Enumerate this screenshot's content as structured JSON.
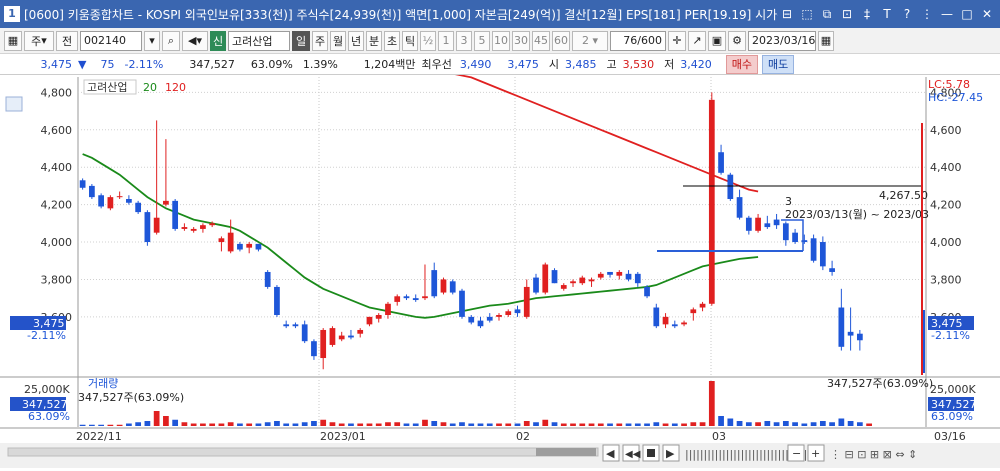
{
  "window": {
    "title": "[0600] 키움종합차트 - KOSPI 외국인보유[333(천)] 주식수[24,939(천)] 액면[1,000] 자본금[249(억)] 결산[12월] EPS[181] PER[19.19] 시가총",
    "number": "1",
    "controls": [
      "⊟",
      "⬚",
      "⧉",
      "⊡",
      "‡",
      "T",
      "?",
      "⋮",
      "—",
      "□",
      "✕"
    ]
  },
  "toolbar": {
    "type": "주",
    "type2": "전",
    "code": "002140",
    "name_badge": "신",
    "stock_name": "고려산업",
    "periods": [
      "일",
      "주",
      "월",
      "년",
      "분",
      "초",
      "틱"
    ],
    "active_period": "일",
    "fraction": "½",
    "nums": [
      "1",
      "3",
      "5",
      "10",
      "30",
      "45",
      "60"
    ],
    "count_sel": "2",
    "range": "76",
    "range_total": "/600",
    "date": "2023/03/16"
  },
  "quote": {
    "price": "3,475",
    "change_arrow": "▼",
    "change": "75",
    "change_pct": "-2.11%",
    "volume": "347,527",
    "vol_ratio": "63.09%",
    "turnover": "1.39%",
    "amount": "1,204백만",
    "best_label": "최우선",
    "bid": "3,490",
    "ask": "3,475",
    "open_label": "시",
    "open": "3,485",
    "high_label": "고",
    "high": "3,530",
    "low_label": "저",
    "low": "3,420",
    "buy": "매수",
    "sell": "매도"
  },
  "chart": {
    "legend_name": "고려산업",
    "ma1": "20",
    "ma2": "120",
    "lc": "LC:5.78",
    "hc": "HC:-27.45",
    "price_tag": "3,475",
    "price_pct": "-2.11%",
    "hline_label": "4,267.50",
    "annot_num": "3",
    "annot_text": "2023/03/13(월) ~ 2023/03",
    "vol_legend": "거래량",
    "vol_value": "347,527주(63.09%)",
    "vol_right": "347,527주(63.09%)",
    "vol_tick": "25,000K",
    "vol_tag": "347,527",
    "vol_tag_pct": "63.09%",
    "dates": [
      "2022/11",
      "2023/01",
      "02",
      "03"
    ],
    "right_date": "03/16",
    "colors": {
      "up": "#e02020",
      "down": "#1e56d8",
      "ma20": "#1a8a1a",
      "ma120": "#e02020"
    }
  },
  "chart_data": {
    "type": "candlestick",
    "y_ticks": [
      3600,
      3800,
      4000,
      4200,
      4400,
      4600,
      4800
    ],
    "ylim": [
      3300,
      4850
    ],
    "candles": [
      {
        "o": 4330,
        "h": 4340,
        "l": 4280,
        "c": 4290
      },
      {
        "o": 4300,
        "h": 4310,
        "l": 4230,
        "c": 4240
      },
      {
        "o": 4250,
        "h": 4260,
        "l": 4180,
        "c": 4190
      },
      {
        "o": 4180,
        "h": 4250,
        "l": 4170,
        "c": 4240
      },
      {
        "o": 4240,
        "h": 4270,
        "l": 4230,
        "c": 4245
      },
      {
        "o": 4230,
        "h": 4250,
        "l": 4200,
        "c": 4210
      },
      {
        "o": 4210,
        "h": 4220,
        "l": 4150,
        "c": 4160
      },
      {
        "o": 4160,
        "h": 4170,
        "l": 3980,
        "c": 4000
      },
      {
        "o": 4050,
        "h": 4650,
        "l": 4040,
        "c": 4130
      },
      {
        "o": 4200,
        "h": 4550,
        "l": 4190,
        "c": 4220
      },
      {
        "o": 4220,
        "h": 4230,
        "l": 4060,
        "c": 4070
      },
      {
        "o": 4070,
        "h": 4100,
        "l": 4060,
        "c": 4080
      },
      {
        "o": 4060,
        "h": 4080,
        "l": 4050,
        "c": 4070
      },
      {
        "o": 4070,
        "h": 4100,
        "l": 4050,
        "c": 4090
      },
      {
        "o": 4090,
        "h": 4110,
        "l": 4080,
        "c": 4100
      },
      {
        "o": 4000,
        "h": 4030,
        "l": 3950,
        "c": 4020
      },
      {
        "o": 3950,
        "h": 4120,
        "l": 3940,
        "c": 4050
      },
      {
        "o": 3990,
        "h": 4000,
        "l": 3950,
        "c": 3960
      },
      {
        "o": 3970,
        "h": 4000,
        "l": 3940,
        "c": 3990
      },
      {
        "o": 3990,
        "h": 3990,
        "l": 3950,
        "c": 3960
      },
      {
        "o": 3840,
        "h": 3850,
        "l": 3750,
        "c": 3760
      },
      {
        "o": 3760,
        "h": 3770,
        "l": 3600,
        "c": 3610
      },
      {
        "o": 3560,
        "h": 3580,
        "l": 3540,
        "c": 3550
      },
      {
        "o": 3560,
        "h": 3570,
        "l": 3540,
        "c": 3550
      },
      {
        "o": 3560,
        "h": 3580,
        "l": 3460,
        "c": 3470
      },
      {
        "o": 3470,
        "h": 3480,
        "l": 3370,
        "c": 3390
      },
      {
        "o": 3380,
        "h": 3540,
        "l": 3320,
        "c": 3530
      },
      {
        "o": 3450,
        "h": 3550,
        "l": 3440,
        "c": 3540
      },
      {
        "o": 3480,
        "h": 3520,
        "l": 3470,
        "c": 3500
      },
      {
        "o": 3500,
        "h": 3530,
        "l": 3480,
        "c": 3490
      },
      {
        "o": 3510,
        "h": 3540,
        "l": 3490,
        "c": 3530
      },
      {
        "o": 3560,
        "h": 3600,
        "l": 3550,
        "c": 3600
      },
      {
        "o": 3590,
        "h": 3620,
        "l": 3570,
        "c": 3610
      },
      {
        "o": 3610,
        "h": 3680,
        "l": 3590,
        "c": 3670
      },
      {
        "o": 3680,
        "h": 3720,
        "l": 3660,
        "c": 3710
      },
      {
        "o": 3710,
        "h": 3720,
        "l": 3690,
        "c": 3700
      },
      {
        "o": 3700,
        "h": 3720,
        "l": 3680,
        "c": 3690
      },
      {
        "o": 3700,
        "h": 3880,
        "l": 3690,
        "c": 3710
      },
      {
        "o": 3850,
        "h": 3890,
        "l": 3700,
        "c": 3710
      },
      {
        "o": 3730,
        "h": 3810,
        "l": 3720,
        "c": 3800
      },
      {
        "o": 3790,
        "h": 3800,
        "l": 3720,
        "c": 3730
      },
      {
        "o": 3740,
        "h": 3750,
        "l": 3590,
        "c": 3600
      },
      {
        "o": 3600,
        "h": 3610,
        "l": 3560,
        "c": 3570
      },
      {
        "o": 3580,
        "h": 3600,
        "l": 3540,
        "c": 3550
      },
      {
        "o": 3600,
        "h": 3620,
        "l": 3570,
        "c": 3580
      },
      {
        "o": 3600,
        "h": 3620,
        "l": 3580,
        "c": 3610
      },
      {
        "o": 3610,
        "h": 3640,
        "l": 3600,
        "c": 3630
      },
      {
        "o": 3640,
        "h": 3660,
        "l": 3600,
        "c": 3620
      },
      {
        "o": 3600,
        "h": 3800,
        "l": 3590,
        "c": 3760
      },
      {
        "o": 3810,
        "h": 3830,
        "l": 3720,
        "c": 3730
      },
      {
        "o": 3730,
        "h": 3890,
        "l": 3720,
        "c": 3880
      },
      {
        "o": 3850,
        "h": 3860,
        "l": 3780,
        "c": 3780
      },
      {
        "o": 3750,
        "h": 3780,
        "l": 3740,
        "c": 3770
      },
      {
        "o": 3780,
        "h": 3800,
        "l": 3760,
        "c": 3790
      },
      {
        "o": 3780,
        "h": 3820,
        "l": 3770,
        "c": 3810
      },
      {
        "o": 3790,
        "h": 3810,
        "l": 3760,
        "c": 3800
      },
      {
        "o": 3810,
        "h": 3840,
        "l": 3800,
        "c": 3830
      },
      {
        "o": 3840,
        "h": 3840,
        "l": 3810,
        "c": 3825
      },
      {
        "o": 3820,
        "h": 3850,
        "l": 3800,
        "c": 3840
      },
      {
        "o": 3830,
        "h": 3850,
        "l": 3790,
        "c": 3800
      },
      {
        "o": 3830,
        "h": 3840,
        "l": 3760,
        "c": 3780
      },
      {
        "o": 3760,
        "h": 3770,
        "l": 3700,
        "c": 3710
      },
      {
        "o": 3650,
        "h": 3670,
        "l": 3540,
        "c": 3550
      },
      {
        "o": 3560,
        "h": 3620,
        "l": 3540,
        "c": 3600
      },
      {
        "o": 3560,
        "h": 3580,
        "l": 3540,
        "c": 3550
      },
      {
        "o": 3560,
        "h": 3580,
        "l": 3550,
        "c": 3570
      },
      {
        "o": 3620,
        "h": 3650,
        "l": 3580,
        "c": 3640
      },
      {
        "o": 3650,
        "h": 3680,
        "l": 3630,
        "c": 3670
      },
      {
        "o": 3670,
        "h": 4800,
        "l": 3660,
        "c": 4760
      },
      {
        "o": 4480,
        "h": 4520,
        "l": 4360,
        "c": 4370
      },
      {
        "o": 4360,
        "h": 4370,
        "l": 4220,
        "c": 4230
      },
      {
        "o": 4240,
        "h": 4280,
        "l": 4120,
        "c": 4130
      },
      {
        "o": 4130,
        "h": 4140,
        "l": 4040,
        "c": 4060
      },
      {
        "o": 4060,
        "h": 4150,
        "l": 4050,
        "c": 4130
      },
      {
        "o": 4100,
        "h": 4140,
        "l": 4070,
        "c": 4080
      },
      {
        "o": 4120,
        "h": 4150,
        "l": 4070,
        "c": 4090
      },
      {
        "o": 4100,
        "h": 4110,
        "l": 3980,
        "c": 4010
      },
      {
        "o": 4050,
        "h": 4070,
        "l": 3990,
        "c": 4000
      },
      {
        "o": 4010,
        "h": 4040,
        "l": 3990,
        "c": 4000
      },
      {
        "o": 4020,
        "h": 4040,
        "l": 3890,
        "c": 3900
      },
      {
        "o": 4000,
        "h": 4030,
        "l": 3850,
        "c": 3870
      },
      {
        "o": 3860,
        "h": 3900,
        "l": 3820,
        "c": 3840
      },
      {
        "o": 3650,
        "h": 3750,
        "l": 3420,
        "c": 3440
      },
      {
        "o": 3520,
        "h": 3650,
        "l": 3420,
        "c": 3500
      },
      {
        "o": 3510,
        "h": 3530,
        "l": 3420,
        "c": 3475
      }
    ],
    "ma20": [
      4470,
      4450,
      4420,
      4390,
      4360,
      4320,
      4280,
      4240,
      4210,
      4180,
      4160,
      4140,
      4120,
      4110,
      4100,
      4090,
      4080,
      4060,
      4030,
      4000,
      3970,
      3930,
      3890,
      3850,
      3810,
      3780,
      3750,
      3730,
      3710,
      3690,
      3670,
      3650,
      3640,
      3630,
      3620,
      3610,
      3600,
      3595,
      3600,
      3610,
      3620,
      3630,
      3640,
      3650,
      3660,
      3665,
      3670,
      3680,
      3690,
      3700,
      3705,
      3710,
      3715,
      3720,
      3725,
      3730,
      3735,
      3740,
      3745,
      3750,
      3755,
      3760,
      3770,
      3790,
      3810,
      3830,
      3850,
      3870,
      3880,
      3890,
      3900,
      3910,
      3915,
      3920
    ],
    "ma120": [
      5000,
      4990,
      4980,
      4970,
      4960,
      4950,
      4940,
      4930,
      4920,
      4910,
      4900,
      4890,
      4880,
      4860,
      4840,
      4820,
      4800,
      4780,
      4760,
      4740,
      4720,
      4700,
      4680,
      4660,
      4640,
      4620,
      4600,
      4580,
      4560,
      4540,
      4520,
      4500,
      4480,
      4460,
      4440,
      4420,
      4400,
      4380,
      4360,
      4340,
      4320,
      4300,
      4280,
      4270
    ],
    "volume": [
      1,
      1,
      1,
      1,
      1,
      2,
      3,
      4,
      12,
      8,
      5,
      3,
      2,
      2,
      2,
      2,
      3,
      2,
      2,
      2,
      3,
      4,
      2,
      2,
      3,
      4,
      5,
      3,
      2,
      2,
      2,
      2,
      2,
      3,
      3,
      2,
      2,
      5,
      4,
      3,
      2,
      3,
      2,
      2,
      2,
      2,
      2,
      2,
      4,
      3,
      5,
      3,
      2,
      2,
      2,
      2,
      2,
      2,
      2,
      2,
      2,
      2,
      3,
      2,
      2,
      2,
      3,
      3,
      36,
      8,
      6,
      4,
      3,
      3,
      4,
      3,
      4,
      3,
      2,
      3,
      4,
      3,
      6,
      4,
      3,
      2
    ]
  }
}
